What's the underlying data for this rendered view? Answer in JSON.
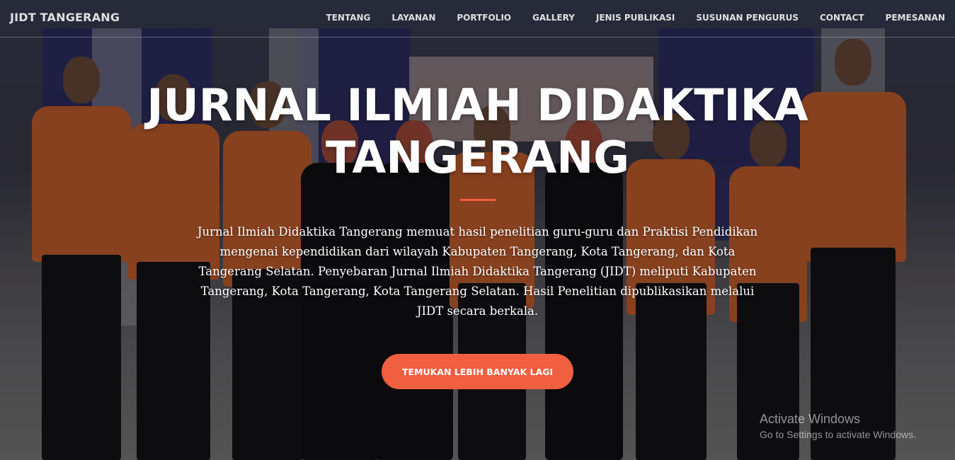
{
  "navbar": {
    "brand": "JIDT TANGERANG",
    "items": [
      "TENTANG",
      "LAYANAN",
      "PORTFOLIO",
      "GALLERY",
      "JENIS PUBLIKASI",
      "SUSUNAN PENGURUS",
      "CONTACT",
      "PEMESANAN"
    ]
  },
  "hero": {
    "title_line1": "JURNAL ILMIAH DIDAKTIKA",
    "title_line2": "TANGERANG",
    "description": "Jurnal Ilmiah Didaktika Tangerang memuat hasil penelitian guru-guru dan Praktisi Pendidikan mengenai kependidikan dari wilayah Kabupaten Tangerang, Kota Tangerang, dan Kota Tangerang Selatan. Penyebaran Jurnal Ilmiah Didaktika Tangerang (JIDT) meliputi Kabupaten Tangerang, Kota Tangerang, Kota Tangerang Selatan. Hasil Penelitian dipublikasikan melalui JIDT secara berkala.",
    "cta_label": "TEMUKAN LEBIH BANYAK LAGI"
  },
  "watermark": {
    "line1": "Activate Windows",
    "line2": "Go to Settings to activate Windows."
  },
  "colors": {
    "accent": "#f05f40",
    "shirt": "#c8602e"
  }
}
